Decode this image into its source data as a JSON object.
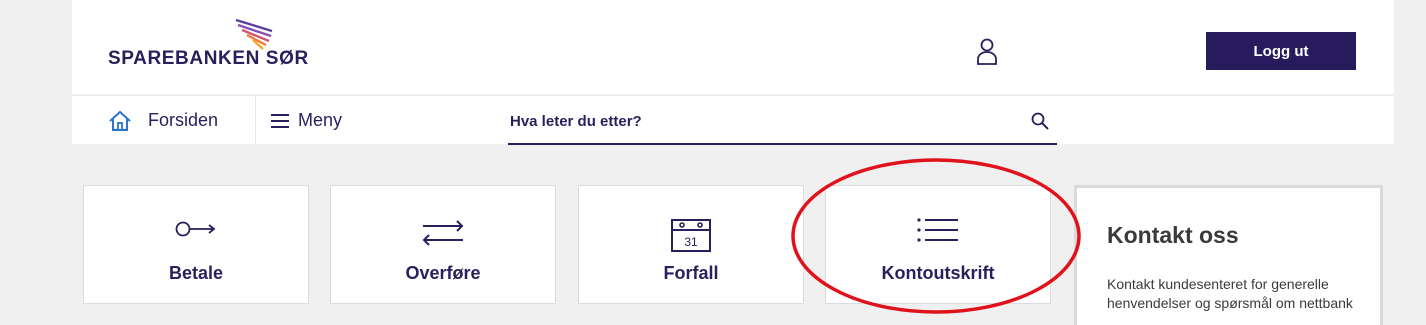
{
  "header": {
    "logo_text": "SPAREBANKEN SØR",
    "logout_label": "Logg ut"
  },
  "nav": {
    "home_label": "Forsiden",
    "menu_label": "Meny",
    "search_placeholder": "Hva leter du etter?"
  },
  "tiles": [
    {
      "label": "Betale",
      "icon": "arrow-right-circle-icon"
    },
    {
      "label": "Overføre",
      "icon": "transfer-arrows-icon"
    },
    {
      "label": "Forfall",
      "icon": "calendar-icon",
      "calendar_day": "31"
    },
    {
      "label": "Kontoutskrift",
      "icon": "list-icon"
    }
  ],
  "contact": {
    "title": "Kontakt oss",
    "text": "Kontakt kundesenteret for generelle henvendelser og spørsmål om nettbank"
  },
  "colors": {
    "brand": "#271b5e",
    "highlight": "#e0121b",
    "page_background": "#f0f0f0"
  }
}
